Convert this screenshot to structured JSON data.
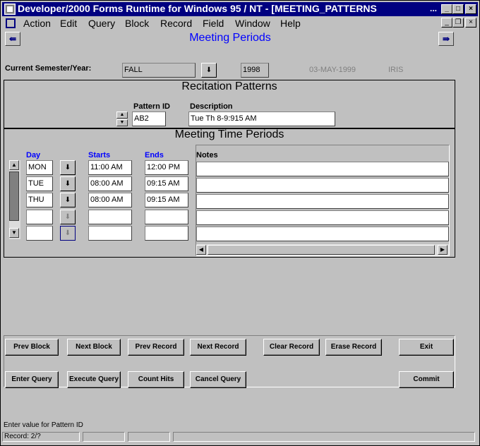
{
  "window": {
    "title": "Developer/2000 Forms Runtime for Windows 95 / NT - [MEETING_PATTERNS",
    "title_overflow": "..."
  },
  "menu": [
    {
      "label": "Action"
    },
    {
      "label": "Edit"
    },
    {
      "label": "Query"
    },
    {
      "label": "Block"
    },
    {
      "label": "Record"
    },
    {
      "label": "Field"
    },
    {
      "label": "Window"
    },
    {
      "label": "Help"
    }
  ],
  "page": {
    "title": "Meeting Periods"
  },
  "semester": {
    "label": "Current Semester/Year:",
    "term": "FALL",
    "year": "1998",
    "date": "03-MAY-1999",
    "user": "IRIS"
  },
  "recitation": {
    "title": "Recitation Patterns",
    "pattern_id_label": "Pattern ID",
    "pattern_id": "AB2",
    "description_label": "Description",
    "description": "Tue Th 8-9:915 AM"
  },
  "meeting": {
    "title": "Meeting Time Periods",
    "headers": {
      "day": "Day",
      "starts": "Starts",
      "ends": "Ends",
      "notes": "Notes"
    },
    "rows": [
      {
        "day": "MON",
        "starts": "11:00 AM",
        "ends": "12:00 PM",
        "notes": ""
      },
      {
        "day": "TUE",
        "starts": "08:00 AM",
        "ends": "09:15 AM",
        "notes": ""
      },
      {
        "day": "THU",
        "starts": "08:00 AM",
        "ends": "09:15 AM",
        "notes": ""
      },
      {
        "day": "",
        "starts": "",
        "ends": "",
        "notes": ""
      },
      {
        "day": "",
        "starts": "",
        "ends": "",
        "notes": ""
      }
    ]
  },
  "buttons": {
    "prev_block": "Prev Block",
    "next_block": "Next Block",
    "prev_record": "Prev Record",
    "next_record": "Next Record",
    "clear_record": "Clear Record",
    "erase_record": "Erase Record",
    "exit": "Exit",
    "enter_query": "Enter Query",
    "execute_query": "Execute Query",
    "count_hits": "Count Hits",
    "cancel_query": "Cancel Query",
    "commit": "Commit"
  },
  "status": {
    "message": "Enter value for Pattern ID",
    "record": "Record: 2/?"
  }
}
